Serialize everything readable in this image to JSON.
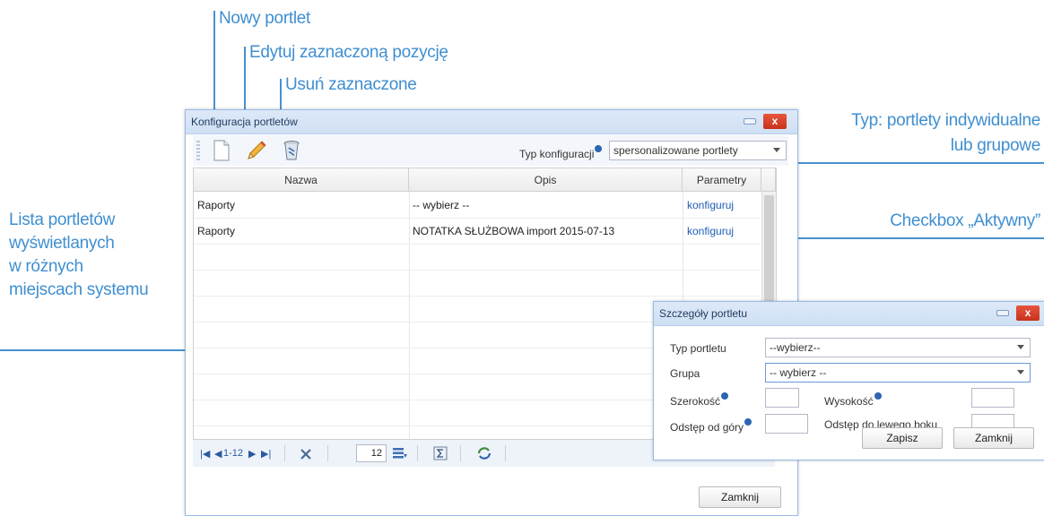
{
  "callouts": {
    "new_portlet": "Nowy portlet",
    "edit_selected": "Edytuj zaznaczoną pozycję",
    "delete_selected": "Usuń zaznaczone",
    "type_line1": "Typ: portlety indywidualne",
    "type_line2": "lub grupowe",
    "checkbox_active": "Checkbox „Aktywny”",
    "list_line1": "Lista portletów",
    "list_line2": "wyświetlanych",
    "list_line3": "w różnych",
    "list_line4": "miejscach systemu"
  },
  "main_window": {
    "title": "Konfiguracja portletów",
    "close_glyph": "x",
    "config_type_label": "Typ konfiguracji",
    "config_type_value": "spersonalizowane portlety",
    "columns": [
      "Nazwa",
      "Opis",
      "Parametry"
    ],
    "rows": [
      {
        "name": "Raporty",
        "desc": "-- wybierz --",
        "param": "konfiguruj"
      },
      {
        "name": "Raporty",
        "desc": "NOTATKA SŁUŻBOWA import 2015-07-13",
        "param": "konfiguruj"
      }
    ],
    "pager": {
      "range": "1-12",
      "page_size": "12"
    },
    "close_button": "Zamknij"
  },
  "details_window": {
    "title": "Szczegóły portletu",
    "close_glyph": "x",
    "portlet_type_label": "Typ portletu",
    "portlet_type_value": "--wybierz--",
    "group_label": "Grupa",
    "group_value": "-- wybierz --",
    "width_label": "Szerokość",
    "height_label": "Wysokość",
    "top_offset_label": "Odstęp od góry",
    "left_offset_label": "Odstęp do lewego boku",
    "save_button": "Zapisz",
    "close_button": "Zamknij"
  },
  "colors": {
    "callout": "#3f8fd0",
    "link": "#1f5db5",
    "close_red": "#d9412a"
  }
}
